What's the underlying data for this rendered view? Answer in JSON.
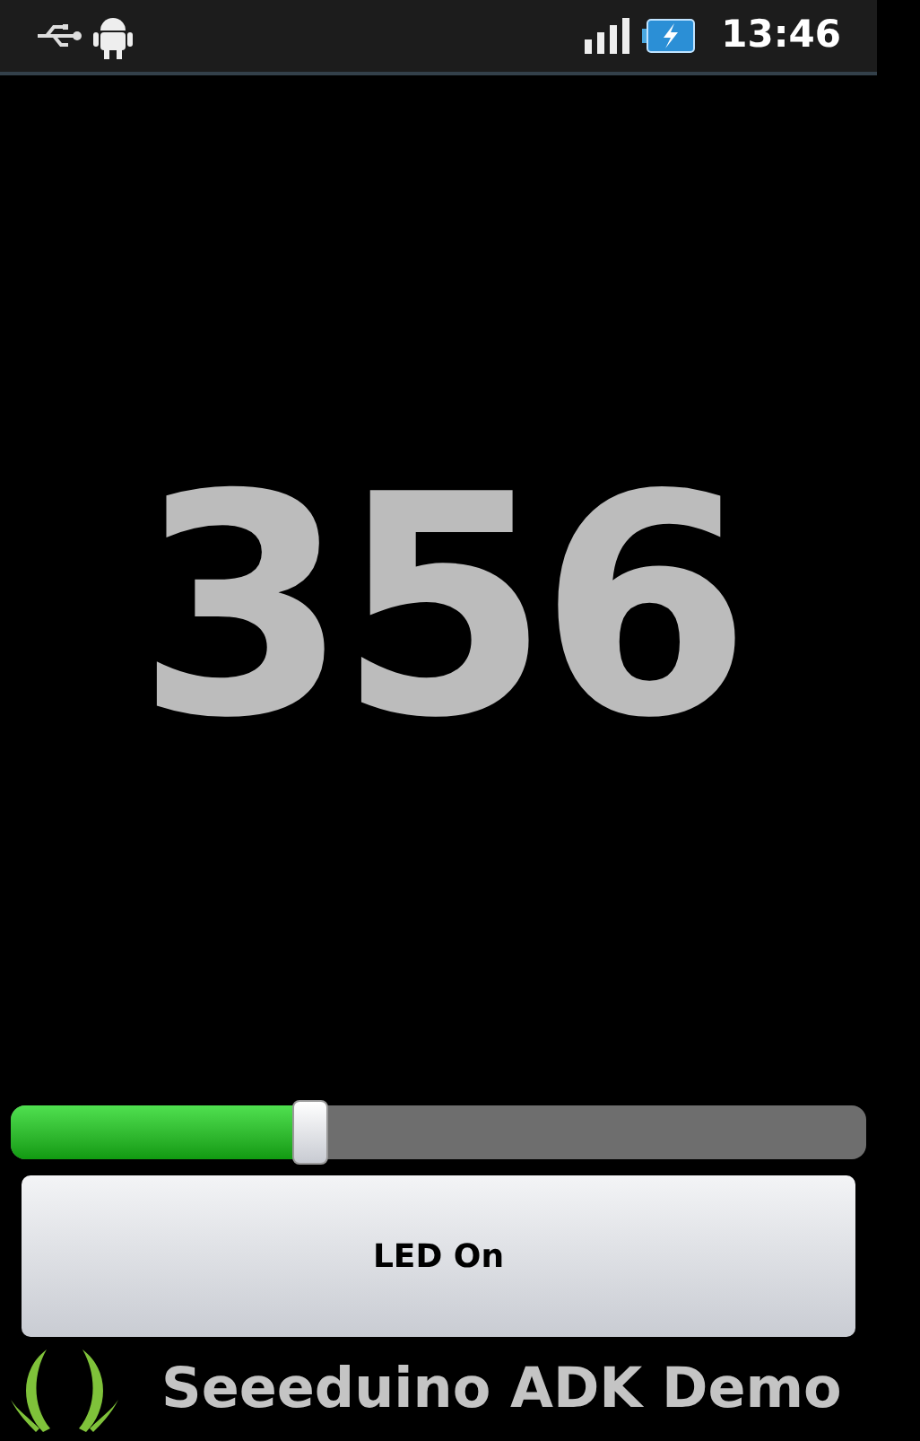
{
  "status_bar": {
    "time": "13:46"
  },
  "reading": "356",
  "slider": {
    "level": 0.35
  },
  "button": {
    "label": "LED On"
  },
  "footer": {
    "title": "Seeeduino ADK Demo"
  }
}
